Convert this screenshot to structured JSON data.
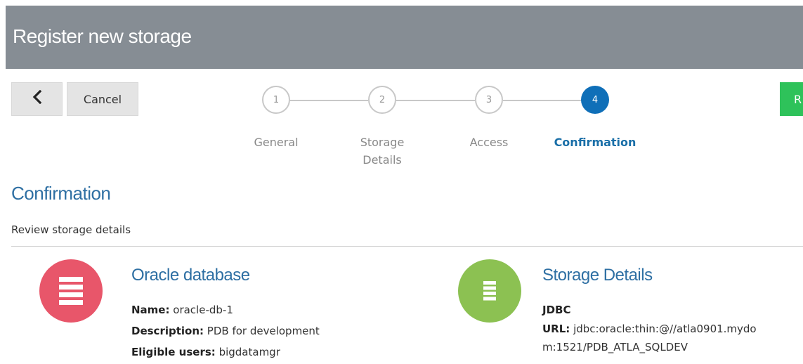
{
  "header": {
    "title": "Register new storage"
  },
  "toolbar": {
    "back_label": "‹",
    "cancel_label": "Cancel",
    "register_label": "R"
  },
  "steps": [
    {
      "number": "1",
      "label": "General"
    },
    {
      "number": "2",
      "label": "Storage Details"
    },
    {
      "number": "3",
      "label": "Access"
    },
    {
      "number": "4",
      "label": "Confirmation"
    }
  ],
  "active_step": 4,
  "section": {
    "title": "Confirmation",
    "subtitle": "Review storage details"
  },
  "database_card": {
    "title": "Oracle database",
    "name_label": "Name:",
    "name_value": "oracle-db-1",
    "description_label": "Description:",
    "description_value": "PDB for development",
    "users_label": "Eligible users:",
    "users_value": "bigdatamgr"
  },
  "storage_card": {
    "title": "Storage Details",
    "type": "JDBC",
    "url_label": "URL:",
    "url_line1": "jdbc:oracle:thin:@//atla0901.mydo",
    "url_line2": "m:1521/PDB_ATLA_SQLDEV"
  },
  "colors": {
    "header_bg": "#868d94",
    "accent_blue": "#0f6fb8",
    "database_icon": "#e8566a",
    "storage_icon": "#8cc152",
    "register_button": "#2ec25a"
  }
}
